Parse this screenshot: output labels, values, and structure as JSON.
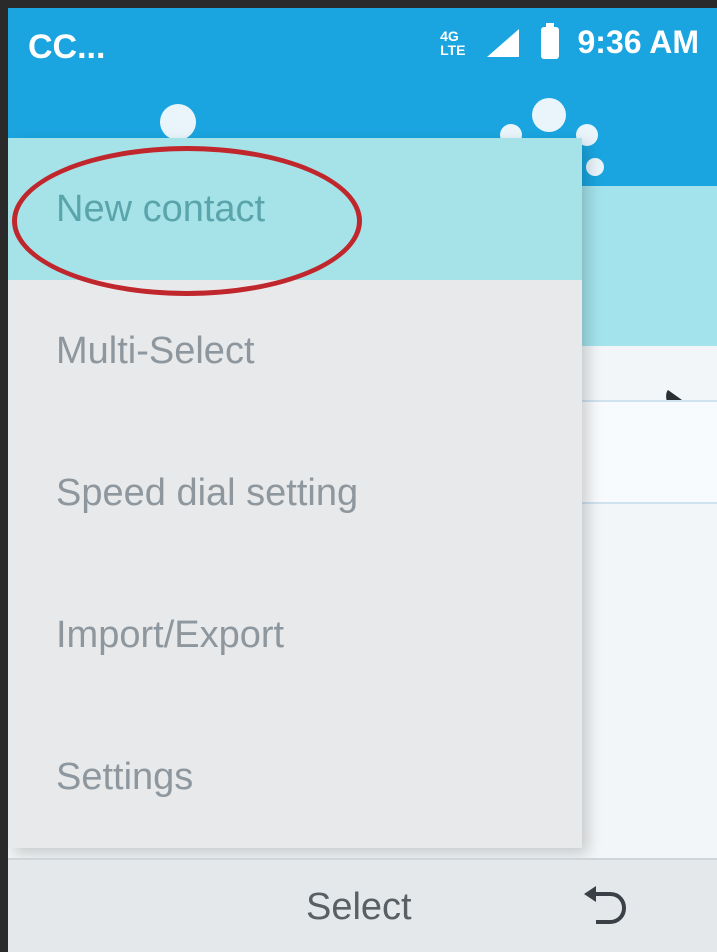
{
  "status_bar": {
    "carrier": "CC...",
    "network_top": "4G",
    "network_bottom": "LTE",
    "time": "9:36 AM",
    "signal_icon": "signal-icon",
    "battery_icon": "battery-icon",
    "color": "#1aa5e0"
  },
  "header": {
    "tab_icons": [
      "contact-icon",
      "group-icon"
    ]
  },
  "list": {
    "call_icon": "phone-icon"
  },
  "menu": {
    "items": [
      {
        "label": "New contact",
        "selected": true
      },
      {
        "label": "Multi-Select",
        "selected": false
      },
      {
        "label": "Speed dial setting",
        "selected": false
      },
      {
        "label": "Import/Export",
        "selected": false
      },
      {
        "label": "Settings",
        "selected": false
      }
    ],
    "highlight_color": "#a6e3e9",
    "annotation_color": "#c0272d"
  },
  "softkeys": {
    "center_label": "Select",
    "right_icon": "back-icon"
  }
}
